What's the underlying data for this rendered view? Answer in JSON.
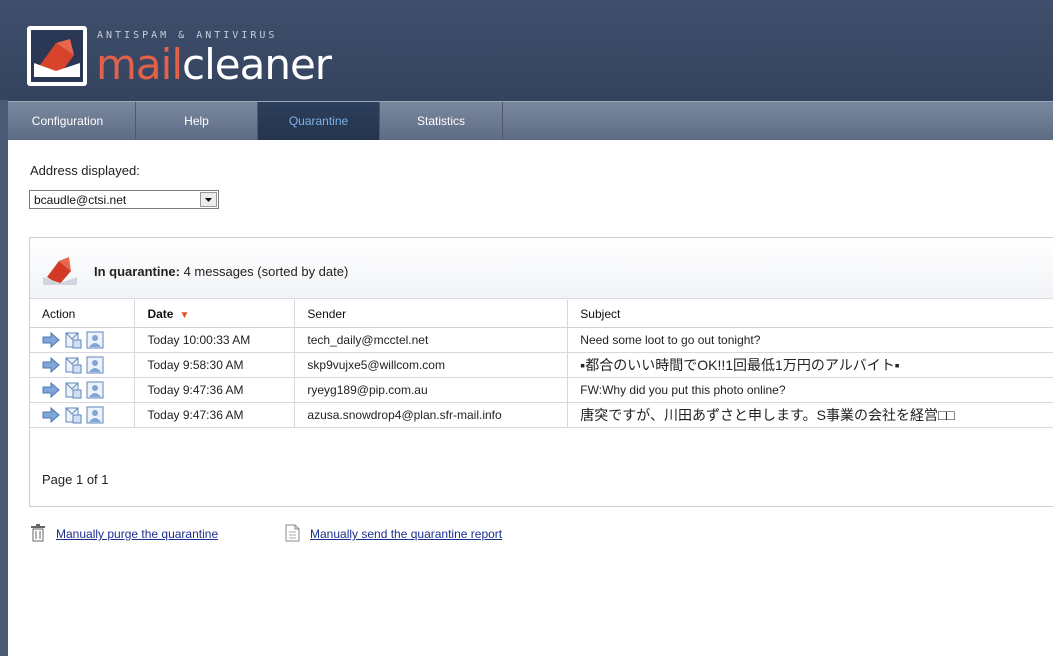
{
  "header": {
    "tagline": "ANTISPAM & ANTIVIRUS",
    "brand_mail": "mail",
    "brand_cleaner": "cleaner",
    "colors": {
      "header_bg": "#3a4966",
      "brand_accent": "#e2614a"
    }
  },
  "nav": {
    "tabs": [
      {
        "label": "Configuration"
      },
      {
        "label": "Help"
      },
      {
        "label": "Quarantine"
      },
      {
        "label": "Statistics"
      }
    ],
    "active": "Quarantine"
  },
  "address": {
    "label": "Address displayed:",
    "selected": "bcaudle@ctsi.net"
  },
  "quarantine": {
    "title_bold": "In quarantine:",
    "title_rest": " 4 messages (sorted by date)",
    "columns": {
      "action": "Action",
      "date": "Date",
      "sender": "Sender",
      "subject": "Subject"
    },
    "rows": [
      {
        "date": "Today 10:00:33 AM",
        "sender": "tech_daily@mcctel.net",
        "subject": "Need some loot to go out tonight?"
      },
      {
        "date": "Today 9:58:30 AM",
        "sender": "skp9vujxe5@willcom.com",
        "subject": "▪都合のいい時間でOK!!1回最低1万円のアルバイト▪"
      },
      {
        "date": "Today 9:47:36 AM",
        "sender": "ryeyg189@pip.com.au",
        "subject": "FW:Why did you put this photo online?"
      },
      {
        "date": "Today 9:47:36 AM",
        "sender": "azusa.snowdrop4@plan.sfr-mail.info",
        "subject": "唐突ですが、川田あずさと申します。S事業の会社を経営□□"
      }
    ],
    "page_info": "Page 1 of 1"
  },
  "links": {
    "purge": "Manually purge the quarantine",
    "send_report": "Manually send the quarantine report"
  }
}
